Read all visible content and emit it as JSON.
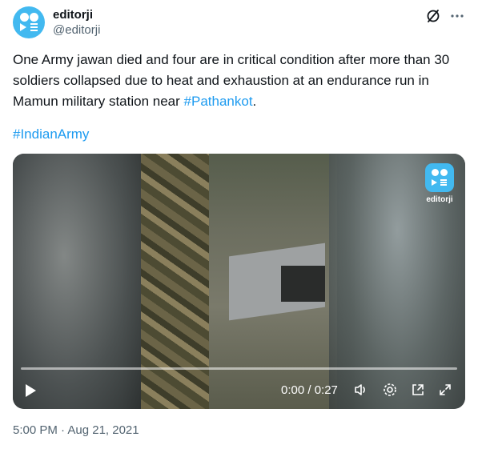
{
  "tweet": {
    "display_name": "editorji",
    "handle": "@editorji",
    "text_main": "One Army jawan died and four are in critical condition after more than 30 soldiers collapsed due to heat and exhaustion at an endurance run in Mamun military station near ",
    "hashtag_inline": "#Pathankot",
    "text_end": ".",
    "hashtag_line": "#IndianArmy",
    "timestamp": "5:00 PM · Aug 21, 2021"
  },
  "video": {
    "watermark": "editorji",
    "time_display": "0:00 / 0:27",
    "progress": 0
  },
  "icons": {
    "avatar": "editorji-logo",
    "header_left": "grok-icon",
    "header_right": "more-icon",
    "play": "play-icon",
    "volume": "volume-icon",
    "settings": "settings-icon",
    "pip": "pip-icon",
    "fullscreen": "fullscreen-icon"
  },
  "colors": {
    "accent": "#1d9bf0",
    "brand": "#42b9f0",
    "secondary_text": "#536471"
  }
}
